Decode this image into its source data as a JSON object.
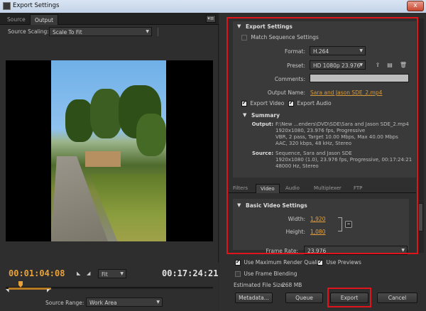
{
  "window": {
    "title": "Export Settings",
    "close_label": "x"
  },
  "left": {
    "tabs": [
      {
        "label": "Source"
      },
      {
        "label": "Output"
      }
    ],
    "panel_menu": "▾≡",
    "source_scaling_label": "Source Scaling:",
    "source_scaling_value": "Scale To Fit",
    "current_timecode": "00:01:04:08",
    "zoom_value": "Fit",
    "duration_timecode": "00:17:24:21",
    "source_range_label": "Source Range:",
    "source_range_value": "Work Area"
  },
  "export_settings": {
    "header": "Export Settings",
    "match_sequence_label": "Match Sequence Settings",
    "format_label": "Format:",
    "format_value": "H.264",
    "preset_label": "Preset:",
    "preset_value": "HD 1080p 23.976",
    "comments_label": "Comments:",
    "comments_value": "",
    "output_name_label": "Output Name:",
    "output_name_value": "Sara and Jason SDE_2.mp4",
    "export_video_label": "Export Video",
    "export_audio_label": "Export Audio",
    "summary_header": "Summary",
    "output_label": "Output:",
    "output_lines": [
      "F:\\New ...enders\\DVD\\SDE\\Sara and Jason SDE_2.mp4",
      "1920x1080, 23.976 fps, Progressive",
      "VBR, 2 pass, Target 10.00 Mbps, Max 40.00 Mbps",
      "AAC, 320 kbps, 48 kHz, Stereo"
    ],
    "source_label": "Source:",
    "source_lines": [
      "Sequence, Sara and Jason SDE",
      "1920x1080 (1.0), 23.976 fps, Progressive, 00:17:24:21",
      "48000 Hz, Stereo"
    ]
  },
  "settings_tabs": [
    {
      "label": "Filters"
    },
    {
      "label": "Video"
    },
    {
      "label": "Audio"
    },
    {
      "label": "Multiplexer"
    },
    {
      "label": "FTP"
    }
  ],
  "basic_video": {
    "header": "Basic Video Settings",
    "width_label": "Width:",
    "width_value": "1,920",
    "height_label": "Height:",
    "height_value": "1,080",
    "frame_rate_label": "Frame Rate:",
    "frame_rate_value": "23.976"
  },
  "bottom": {
    "max_render_quality_label": "Use Maximum Render Quality",
    "use_previews_label": "Use Previews",
    "frame_blending_label": "Use Frame Blending",
    "file_size_label": "Estimated File Size:",
    "file_size_value": "268 MB",
    "metadata_button": "Metadata...",
    "queue_button": "Queue",
    "export_button": "Export",
    "cancel_button": "Cancel"
  },
  "colors": {
    "highlight": "#e0151c",
    "accent": "#e8a23c",
    "link": "#d89b3c"
  },
  "icons": [
    "save-preset-icon",
    "import-preset-icon",
    "delete-preset-icon",
    "link-icon",
    "close-icon"
  ]
}
